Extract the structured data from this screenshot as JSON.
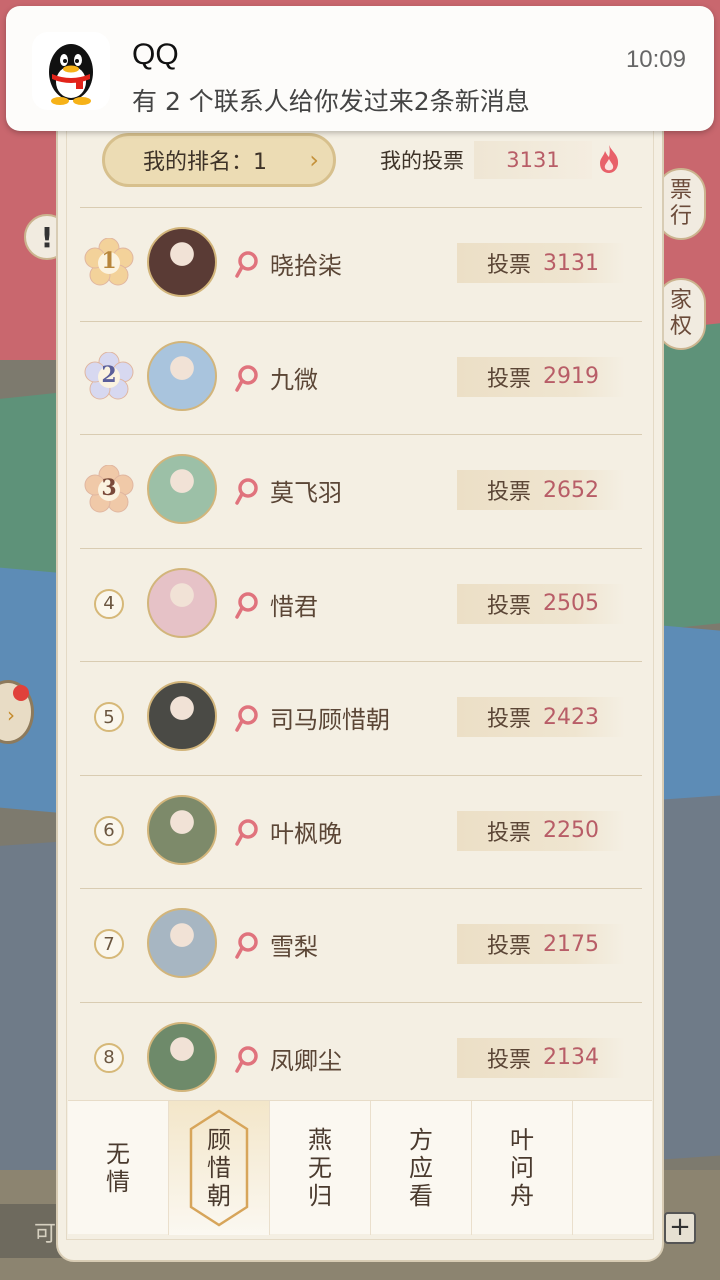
{
  "notification": {
    "app": "QQ",
    "time": "10:09",
    "message": "有 2 个联系人给你发过来2条新消息"
  },
  "header": {
    "my_rank_label": "我的排名：1",
    "my_vote_label": "我的投票",
    "my_vote_value": "3131"
  },
  "side_buttons": {
    "vote_rank": "票行",
    "family_rights": "家权"
  },
  "bottom_input_placeholder": "可",
  "vote_button_label": "投票",
  "ranking": [
    {
      "rank": "1",
      "name": "晓拾柒",
      "votes": "3131"
    },
    {
      "rank": "2",
      "name": "九微",
      "votes": "2919"
    },
    {
      "rank": "3",
      "name": "莫飞羽",
      "votes": "2652"
    },
    {
      "rank": "4",
      "name": "惜君",
      "votes": "2505"
    },
    {
      "rank": "5",
      "name": "司马顾惜朝",
      "votes": "2423"
    },
    {
      "rank": "6",
      "name": "叶枫晚",
      "votes": "2250"
    },
    {
      "rank": "7",
      "name": "雪梨",
      "votes": "2175"
    },
    {
      "rank": "8",
      "name": "凤卿尘",
      "votes": "2134"
    }
  ],
  "tabs": [
    {
      "label": "无情",
      "active": false
    },
    {
      "label": "顾惜朝",
      "active": true
    },
    {
      "label": "燕无归",
      "active": false
    },
    {
      "label": "方应看",
      "active": false
    },
    {
      "label": "叶问舟",
      "active": false
    }
  ],
  "colors": {
    "vote_count": "#b85d67",
    "badge_gold": "#d6b878",
    "panel_bg": "#f4efe3"
  }
}
